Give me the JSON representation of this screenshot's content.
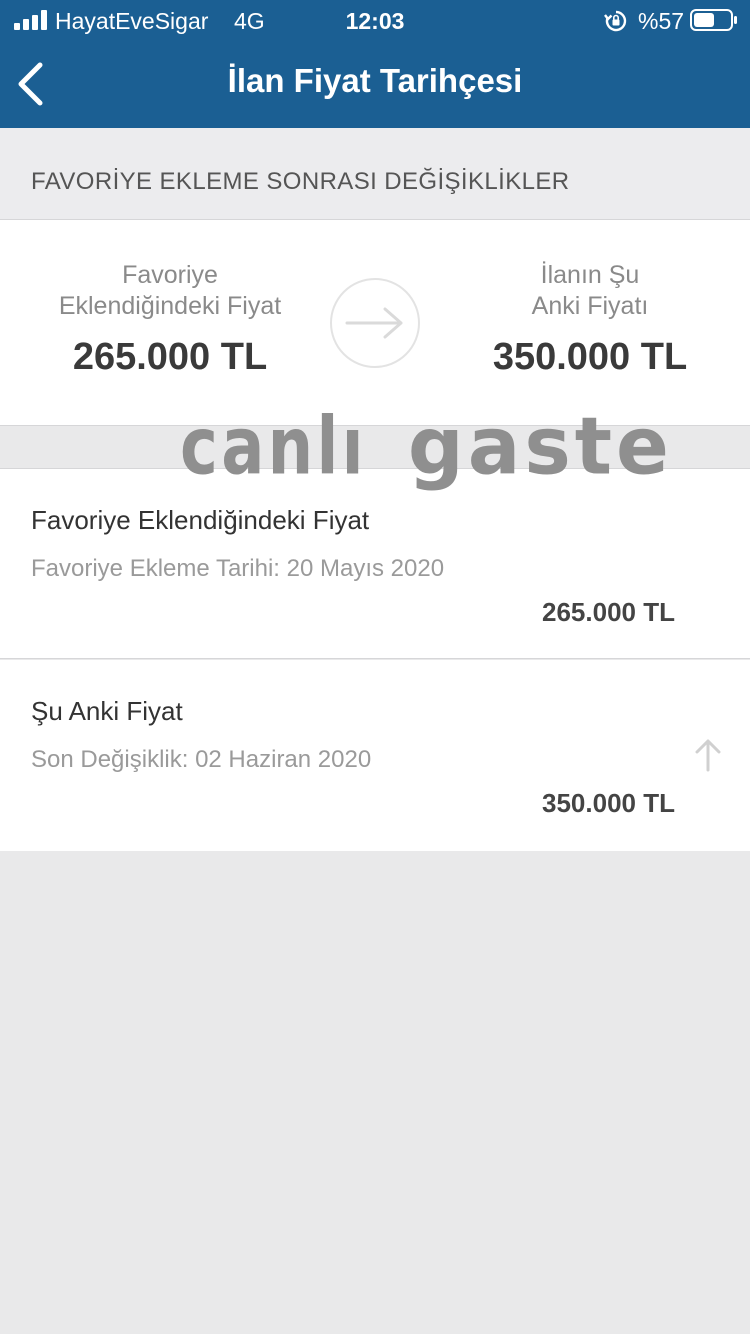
{
  "status_bar": {
    "carrier": "HayatEveSigar",
    "network": "4G",
    "time": "12:03",
    "battery": "%57"
  },
  "header": {
    "title": "İlan Fiyat Tarihçesi",
    "back_icon": "chevron-left-icon"
  },
  "section": {
    "heading": "FAVORİYE EKLEME SONRASI DEĞİŞİKLİKLER"
  },
  "comparison": {
    "left_label_line1": "Favoriye",
    "left_label_line2": "Eklendiğindeki Fiyat",
    "left_price": "265.000 TL",
    "right_label_line1": "İlanın Şu",
    "right_label_line2": "Anki Fiyatı",
    "right_price": "350.000 TL",
    "arrow_icon": "arrow-right-icon"
  },
  "watermark": {
    "part1": "canlı",
    "part2": "gaste"
  },
  "history": [
    {
      "title": "Favoriye Eklendiğindeki Fiyat",
      "subtitle": "Favoriye Ekleme Tarihi: 20 Mayıs 2020",
      "price": "265.000 TL"
    },
    {
      "title": "Şu Anki Fiyat",
      "subtitle": "Son Değişiklik: 02 Haziran 2020",
      "price": "350.000 TL",
      "trend_icon": "arrow-up-icon"
    }
  ],
  "colors": {
    "header_bg": "#1b5f93",
    "page_bg": "#e9e9ea"
  }
}
